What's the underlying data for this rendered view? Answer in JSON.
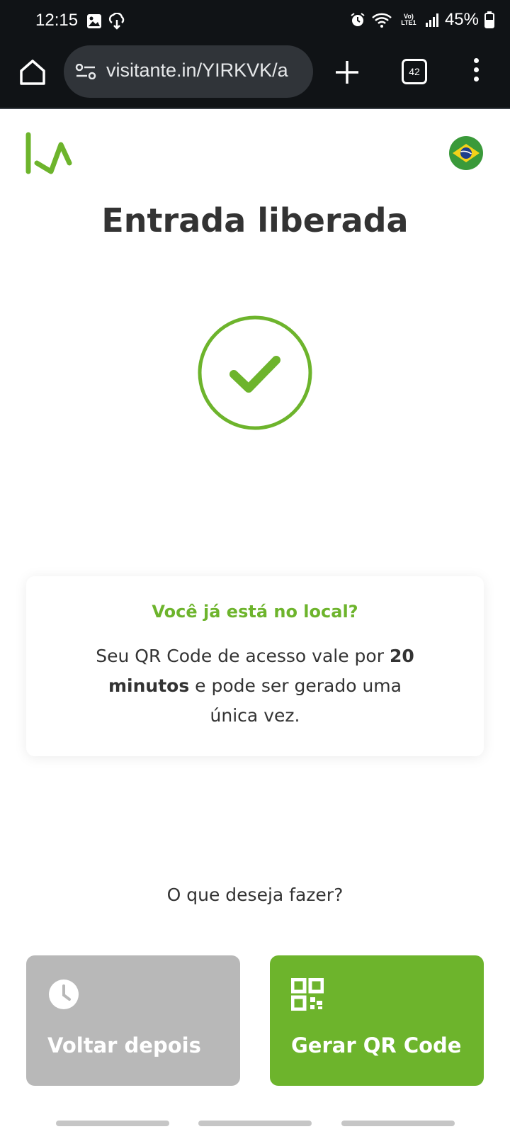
{
  "status_bar": {
    "time": "12:15",
    "network_label": "Vo) LTE1",
    "battery": "45%",
    "icons": [
      "gallery-icon",
      "cloud-sync-icon",
      "alarm-icon",
      "wifi-icon",
      "signal-icon",
      "battery-icon"
    ]
  },
  "browser": {
    "url": "visitante.in/YIRKVK/a",
    "tab_count": "42",
    "icons": [
      "home-icon",
      "site-settings-icon",
      "new-tab-icon",
      "tabs-icon",
      "menu-icon"
    ]
  },
  "page": {
    "title": "Entrada liberada",
    "language_flag": "brazil-flag-icon",
    "accent_color": "#6db42c"
  },
  "info_card": {
    "title": "Você já está no local?",
    "text_before": "Seu QR Code de acesso vale por ",
    "text_bold": "20 minutos",
    "text_after": " e pode ser gerado uma única vez."
  },
  "actions": {
    "question": "O que deseja fazer?",
    "later_label": "Voltar depois",
    "qr_label": "Gerar QR Code"
  }
}
